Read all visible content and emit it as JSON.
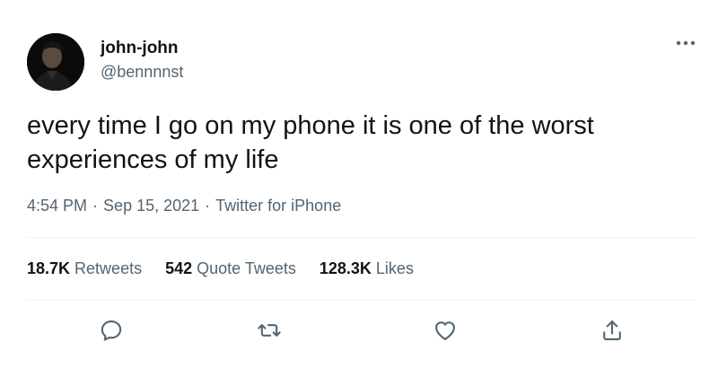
{
  "author": {
    "display_name": "john-john",
    "handle": "@bennnnst"
  },
  "tweet": {
    "text": "every time I go on my phone it is one of the worst experiences of my life",
    "time": "4:54 PM",
    "date": "Sep 15, 2021",
    "source": "Twitter for iPhone",
    "separator": "·"
  },
  "stats": {
    "retweets": {
      "count": "18.7K",
      "label": "Retweets"
    },
    "quote_tweets": {
      "count": "542",
      "label": "Quote Tweets"
    },
    "likes": {
      "count": "128.3K",
      "label": "Likes"
    }
  },
  "icons": {
    "more": "more-horizontal-icon",
    "reply": "reply-icon",
    "retweet": "retweet-icon",
    "like": "heart-icon",
    "share": "share-icon"
  },
  "colors": {
    "text": "#0f1419",
    "secondary": "#536471",
    "divider": "#eff3f4"
  }
}
